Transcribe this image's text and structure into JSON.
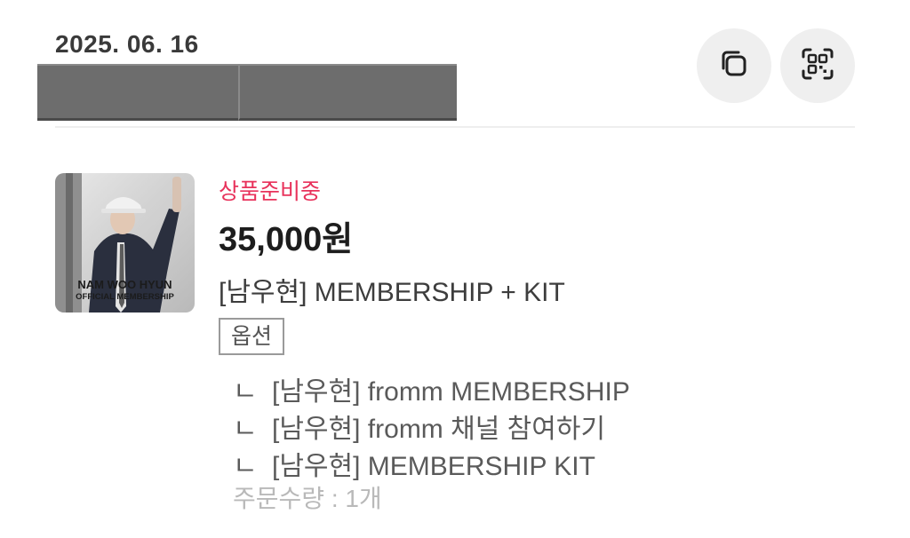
{
  "order": {
    "date": "2025. 06. 16"
  },
  "actions": {
    "copy_icon": "copy-icon",
    "qr_icon": "qr-code-icon"
  },
  "product": {
    "status": "상품준비중",
    "price": "35,000원",
    "name": "[남우현] MEMBERSHIP + KIT",
    "thumbnail": {
      "title": "NAM WOO HYUN",
      "subtitle": "OFFICIAL MEMBERSHIP"
    }
  },
  "options": {
    "badge": "옵션",
    "marker": "ㄴ",
    "items": [
      "[남우현] fromm MEMBERSHIP",
      "[남우현] fromm 채널 참여하기",
      "[남우현] MEMBERSHIP KIT"
    ],
    "quantity": "주문수량 : 1개"
  },
  "colors": {
    "status": "#e8325b",
    "button_bg": "#efefef"
  }
}
